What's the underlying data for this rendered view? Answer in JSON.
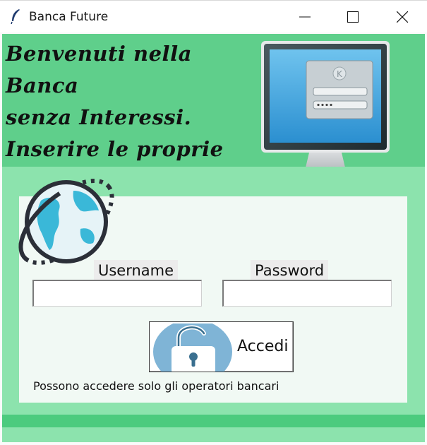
{
  "window": {
    "title": "Banca Future",
    "icon": "feather-icon",
    "controls": [
      "minimize-icon",
      "maximize-icon",
      "close-icon"
    ]
  },
  "header": {
    "welcome": "Benvenuti nella Banca\nsenza Interessi.\nInserire le proprie\nCredenziali",
    "monitor_image": "login-monitor-icon"
  },
  "login": {
    "username_label": "Username",
    "password_label": "Password",
    "username_value": "",
    "password_value": "",
    "button_label": "Accedi",
    "button_icon": "padlock-icon",
    "info": "Possono accedere solo gli operatori bancari"
  },
  "colors": {
    "header_green": "#5fcf8b",
    "body_green": "#8ce3ad",
    "footer_green": "#4ccb7e",
    "panel": "#f1f9f4",
    "lock_circle": "#7fb4d6"
  }
}
